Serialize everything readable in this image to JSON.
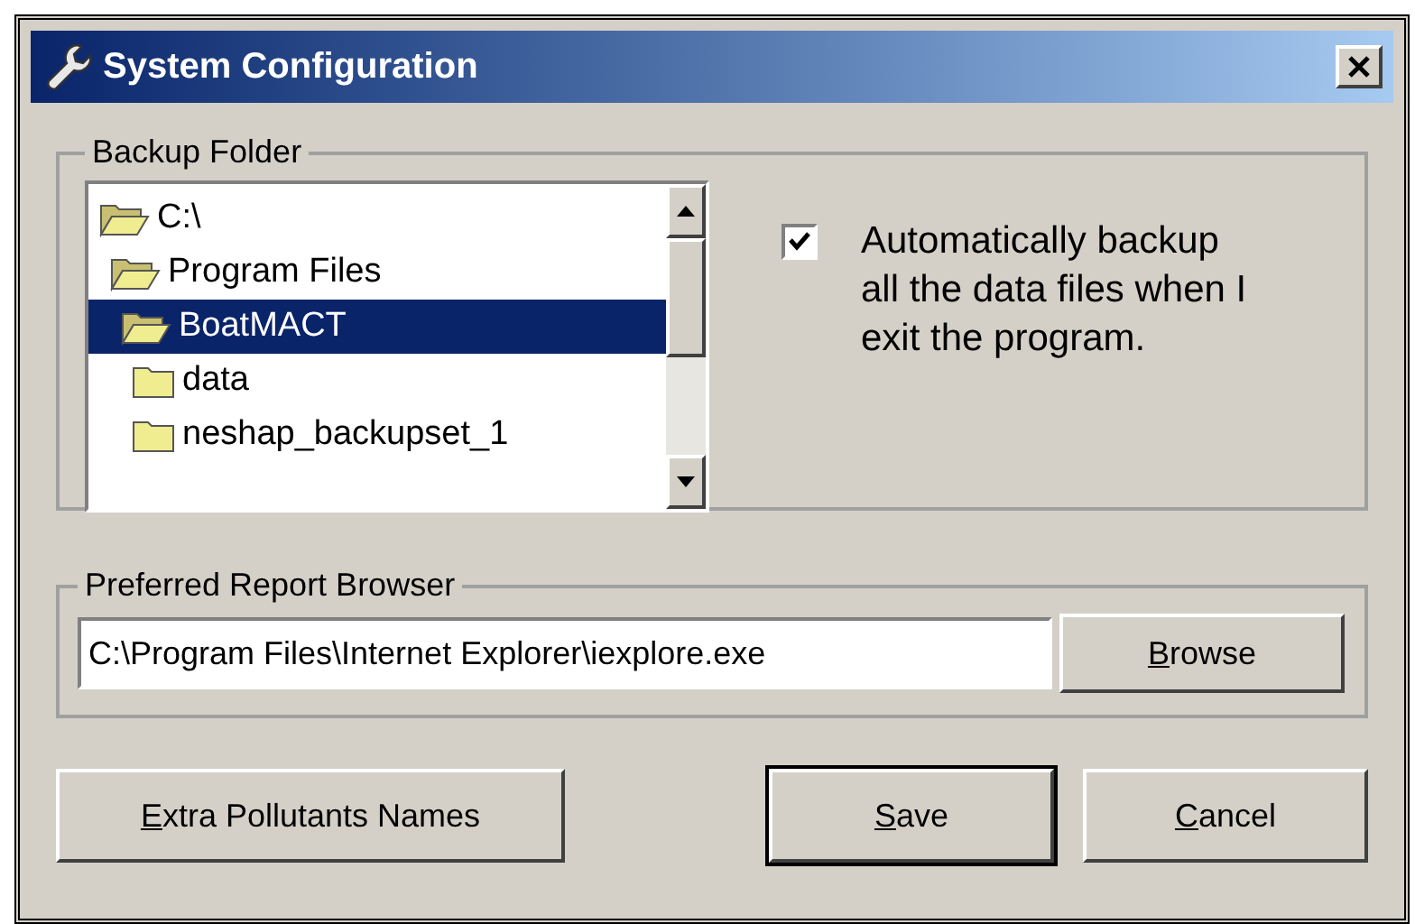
{
  "window": {
    "title": "System Configuration"
  },
  "backup_folder": {
    "label": "Backup Folder",
    "tree": [
      {
        "label": "C:\\",
        "expanded": true,
        "selected": false,
        "children": [
          {
            "label": "Program Files",
            "expanded": true,
            "selected": false,
            "children": [
              {
                "label": "BoatMACT",
                "expanded": true,
                "selected": true,
                "children": [
                  {
                    "label": "data",
                    "expanded": false,
                    "selected": false
                  },
                  {
                    "label": "neshap_backupset_1",
                    "expanded": false,
                    "selected": false
                  }
                ]
              }
            ]
          }
        ]
      }
    ],
    "auto_backup": {
      "label": "Automatically backup all the data files when I exit the program.",
      "checked": true
    }
  },
  "report_browser": {
    "label": "Preferred Report Browser",
    "value": "C:\\Program Files\\Internet Explorer\\iexplore.exe",
    "browse_button": {
      "label": "Browse",
      "mnemonic": true
    }
  },
  "buttons": [
    {
      "label": "Extra Pollutants Names",
      "mnemonic": true,
      "default": false
    },
    {
      "label": "Save",
      "mnemonic": true,
      "default": true
    },
    {
      "label": "Cancel",
      "mnemonic": true,
      "default": false
    }
  ]
}
